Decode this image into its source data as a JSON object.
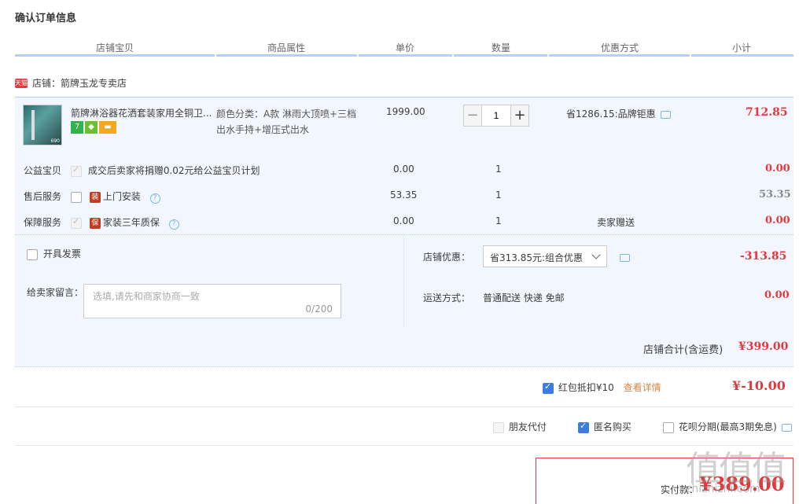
{
  "page_title": "确认订单信息",
  "columns": [
    "店铺宝贝",
    "商品属性",
    "单价",
    "数量",
    "优惠方式",
    "小计"
  ],
  "shop": {
    "badge": "天猫",
    "label": "店铺：箭牌玉龙专卖店"
  },
  "item": {
    "name": "箭牌淋浴器花洒套装家用全铜卫...",
    "attr": "颜色分类：A款 淋雨大顶喷+三档出水手持+增压式出水",
    "price": "1999.00",
    "quantity": "1",
    "discount": "省1286.15:品牌钜惠",
    "subtotal": "712.85",
    "thumb_label": "690",
    "badge_text": "7"
  },
  "services": [
    {
      "label": "公益宝贝",
      "desc": "成交后卖家将捐赠0.02元给公益宝贝计划",
      "price": "0.00",
      "qty": "1",
      "note": "",
      "subtotal": "0.00"
    },
    {
      "label": "售后服务",
      "desc": "上门安装",
      "price": "53.35",
      "qty": "1",
      "note": "",
      "subtotal": "53.35"
    },
    {
      "label": "保障服务",
      "desc": "家装三年质保",
      "price": "0.00",
      "qty": "1",
      "note": "卖家赠送",
      "subtotal": "0.00"
    }
  ],
  "service_icons": {
    "install": "装",
    "warranty": "保"
  },
  "invoice": "开具发票",
  "memo": {
    "label": "给卖家留言：",
    "placeholder": "选填,请先和商家协商一致",
    "counter": "0/200"
  },
  "shop_discount": {
    "label": "店铺优惠：",
    "value": "省313.85元:组合优惠",
    "amount": "-313.85"
  },
  "shipping": {
    "label": "运送方式：",
    "value": "普通配送 快递 免邮",
    "amount": "0.00"
  },
  "shop_total": {
    "label": "店铺合计(含运费)",
    "amount": "¥399.00"
  },
  "red_packet": {
    "label": "红包抵扣¥10",
    "link": "查看详情",
    "amount": "¥-10.00"
  },
  "options": {
    "friend_pay": "朋友代付",
    "anonymous": "匿名购买",
    "installment": "花呗分期(最高3期免息)"
  },
  "pay": {
    "label": "实付款：",
    "amount": "¥389.00"
  },
  "watermark": {
    "big": "值值值",
    "small": "zhizhizhi.com"
  }
}
